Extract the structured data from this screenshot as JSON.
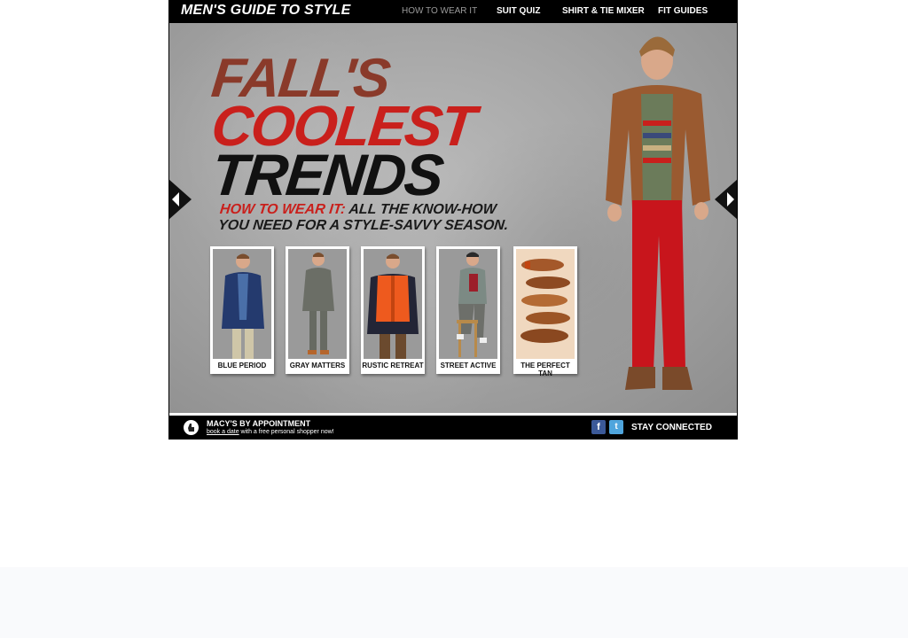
{
  "header": {
    "brand": "MEN'S GUIDE TO STYLE",
    "nav": [
      {
        "label": "HOW TO WEAR IT",
        "active": true
      },
      {
        "label": "SUIT QUIZ",
        "active": false
      },
      {
        "label": "SHIRT & TIE MIXER",
        "active": false
      },
      {
        "label": "FIT GUIDES",
        "active": false
      }
    ]
  },
  "hero": {
    "line1": "FALL'S",
    "line2": "COOLEST",
    "line3": "TRENDS",
    "tagline_red": "HOW TO WEAR IT:",
    "tagline_rest1": " ALL THE KNOW-HOW",
    "tagline_rest2": "YOU NEED FOR A STYLE-SAVVY SEASON."
  },
  "cards": [
    {
      "label": "BLUE PERIOD"
    },
    {
      "label": "GRAY MATTERS"
    },
    {
      "label": "RUSTIC RETREAT"
    },
    {
      "label": "STREET ACTIVE"
    },
    {
      "label": "THE PERFECT TAN"
    }
  ],
  "footer": {
    "appointment_title": "MACY'S BY APPOINTMENT",
    "appointment_link": "book a date",
    "appointment_rest": " with a free personal shopper now!",
    "stay_connected": "STAY CONNECTED"
  },
  "colors": {
    "accent_red": "#c9201c",
    "rust": "#8a3a2a",
    "facebook": "#3b5998",
    "twitter": "#4fa5dd"
  }
}
